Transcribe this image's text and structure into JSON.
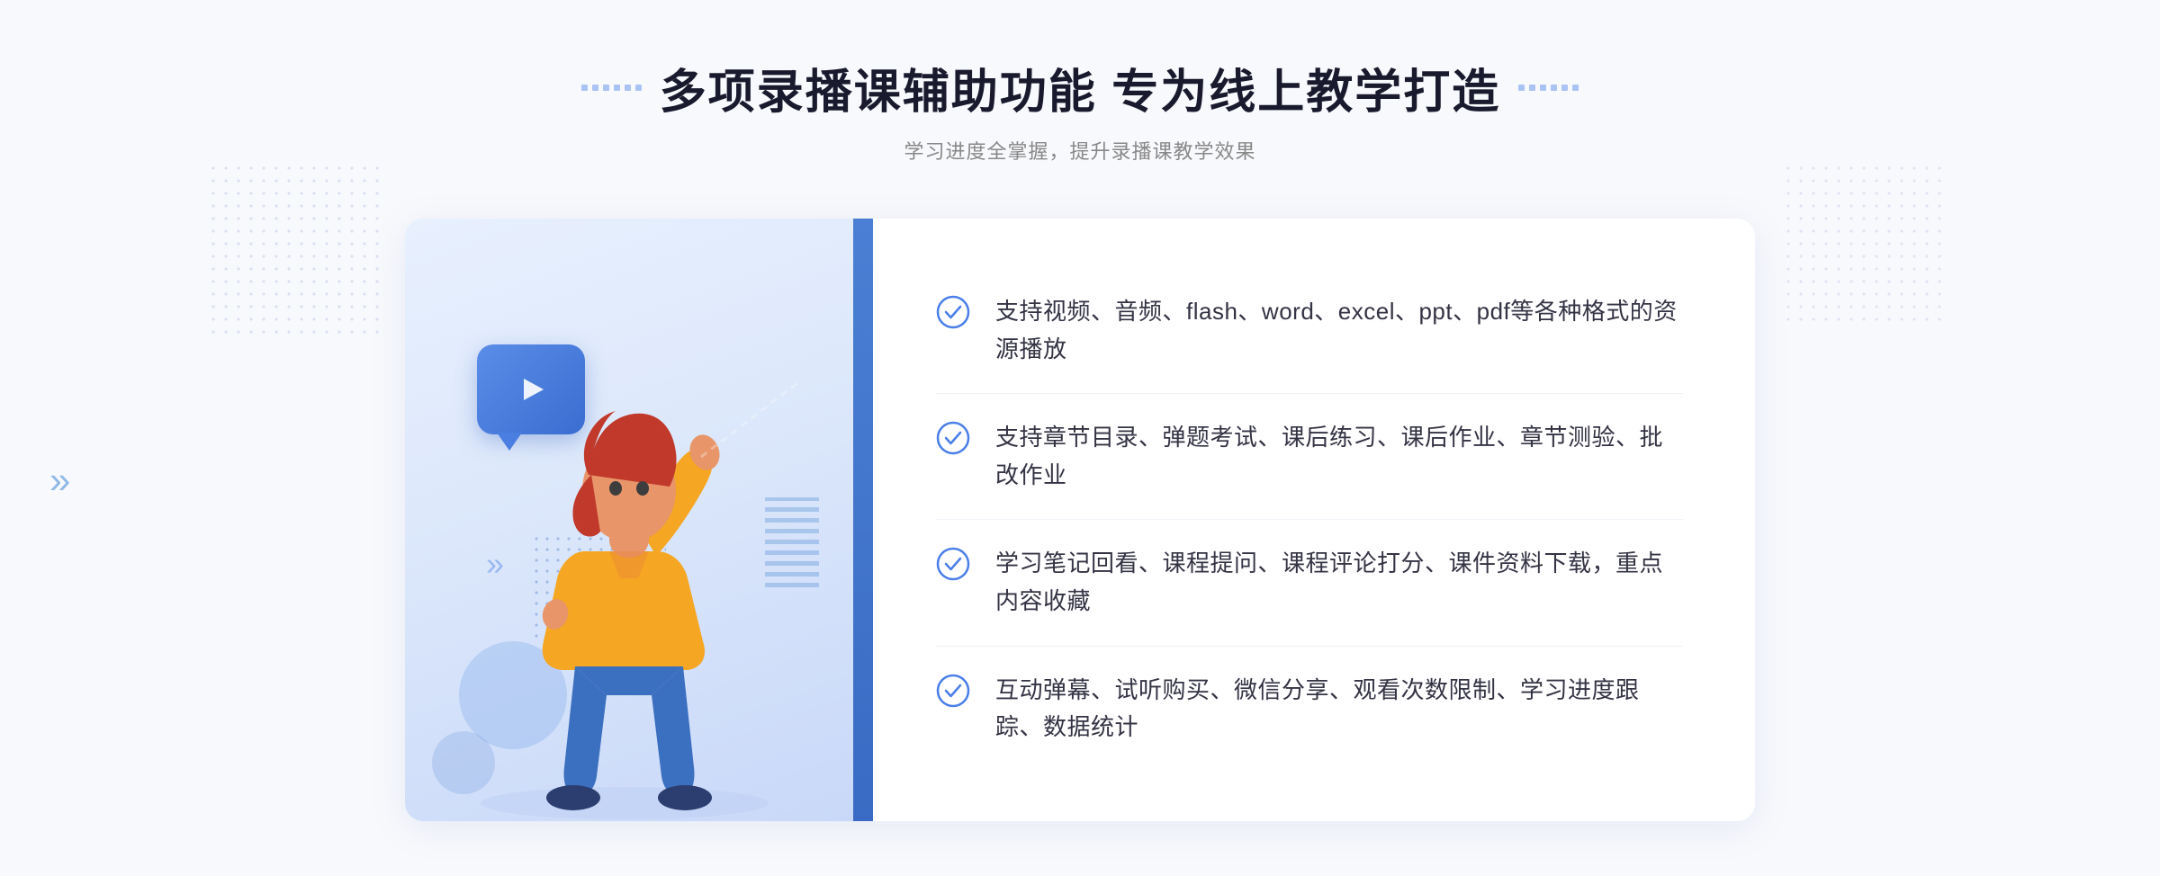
{
  "page": {
    "background": "#f8f9fc"
  },
  "header": {
    "main_title": "多项录播课辅助功能 专为线上教学打造",
    "sub_title": "学习进度全掌握，提升录播课教学效果",
    "decorator_label": "decorator"
  },
  "features": [
    {
      "id": 1,
      "text": "支持视频、音频、flash、word、excel、ppt、pdf等各种格式的资源播放"
    },
    {
      "id": 2,
      "text": "支持章节目录、弹题考试、课后练习、课后作业、章节测验、批改作业"
    },
    {
      "id": 3,
      "text": "学习笔记回看、课程提问、课程评论打分、课件资料下载，重点内容收藏"
    },
    {
      "id": 4,
      "text": "互动弹幕、试听购买、微信分享、观看次数限制、学习进度跟踪、数据统计"
    }
  ],
  "icons": {
    "check_circle": "check-circle-icon",
    "play": "play-icon",
    "arrows_left": "arrows-left-decoration",
    "arrows_right": "arrows-right-decoration"
  }
}
